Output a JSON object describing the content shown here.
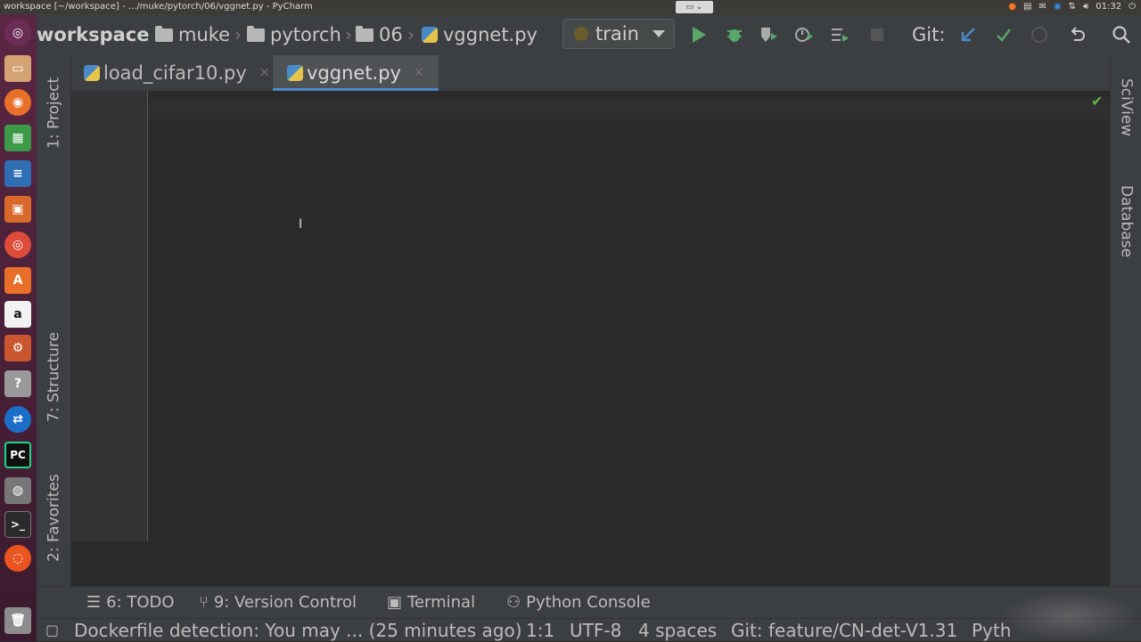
{
  "os": {
    "window_title": "workspace [~/workspace] - .../muke/pytorch/06/vggnet.py - PyCharm",
    "clock": "01:32"
  },
  "navbar": {
    "crumbs": [
      "workspace",
      "muke",
      "pytorch",
      "06",
      "vggnet.py"
    ],
    "run_config": "train",
    "git_label": "Git:"
  },
  "tabs": [
    {
      "label": "load_cifar10.py",
      "active": false
    },
    {
      "label": "vggnet.py",
      "active": true
    }
  ],
  "left_tool_windows": [
    "1: Project",
    "7: Structure",
    "2: Favorites"
  ],
  "right_tool_windows": [
    "SciView",
    "Database"
  ],
  "bottom_tool_windows": [
    "6: TODO",
    "9: Version Control",
    "Terminal",
    "Python Console"
  ],
  "status": {
    "message": "Dockerfile detection: You may ... (25 minutes ago)",
    "position": "1:1",
    "encoding": "UTF-8",
    "indent": "4 spaces",
    "git_branch": "Git: feature/CN-det-V1.31",
    "interpreter": "Pyth"
  },
  "colors": {
    "accent": "#4a88c7",
    "run_green": "#59a869",
    "ok_green": "#62b543"
  }
}
